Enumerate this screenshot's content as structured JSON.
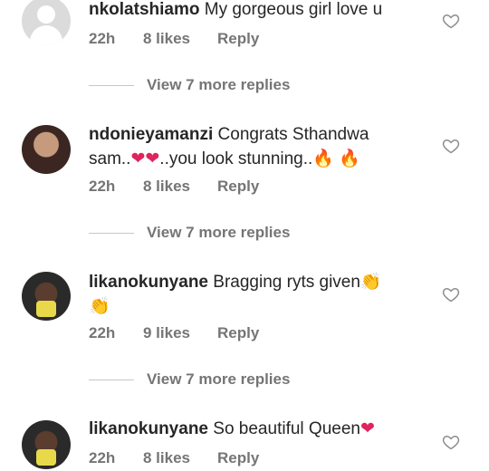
{
  "comments": [
    {
      "username": "nkolatshiamo",
      "text": " My gorgeous girl love u",
      "time": "22h",
      "likes": "8 likes",
      "reply": "Reply",
      "view_replies": "View 7 more replies"
    },
    {
      "username": "ndonieyamanzi",
      "text_a": " Congrats Sthandwa sam..",
      "emoji_hearts": "❤❤",
      "text_b": "..you look stunning..",
      "emoji_fire_1": "🔥",
      "emoji_fire_2": "🔥",
      "time": "22h",
      "likes": "8 likes",
      "reply": "Reply",
      "view_replies": "View 7 more replies"
    },
    {
      "username": "likanokunyane",
      "text": " Bragging ryts given",
      "emoji_clap_1": "👏",
      "emoji_clap_2": "👏",
      "time": "22h",
      "likes": "9 likes",
      "reply": "Reply",
      "view_replies": "View 7 more replies"
    },
    {
      "username": "likanokunyane",
      "text": " So beautiful Queen",
      "emoji_heart": "❤",
      "time": "22h",
      "likes": "8 likes",
      "reply": "Reply"
    }
  ],
  "icons": {
    "like": "heart-outline-icon"
  },
  "colors": {
    "meta": "#757575",
    "text": "#262626",
    "heart_emoji": "#e0245e"
  }
}
